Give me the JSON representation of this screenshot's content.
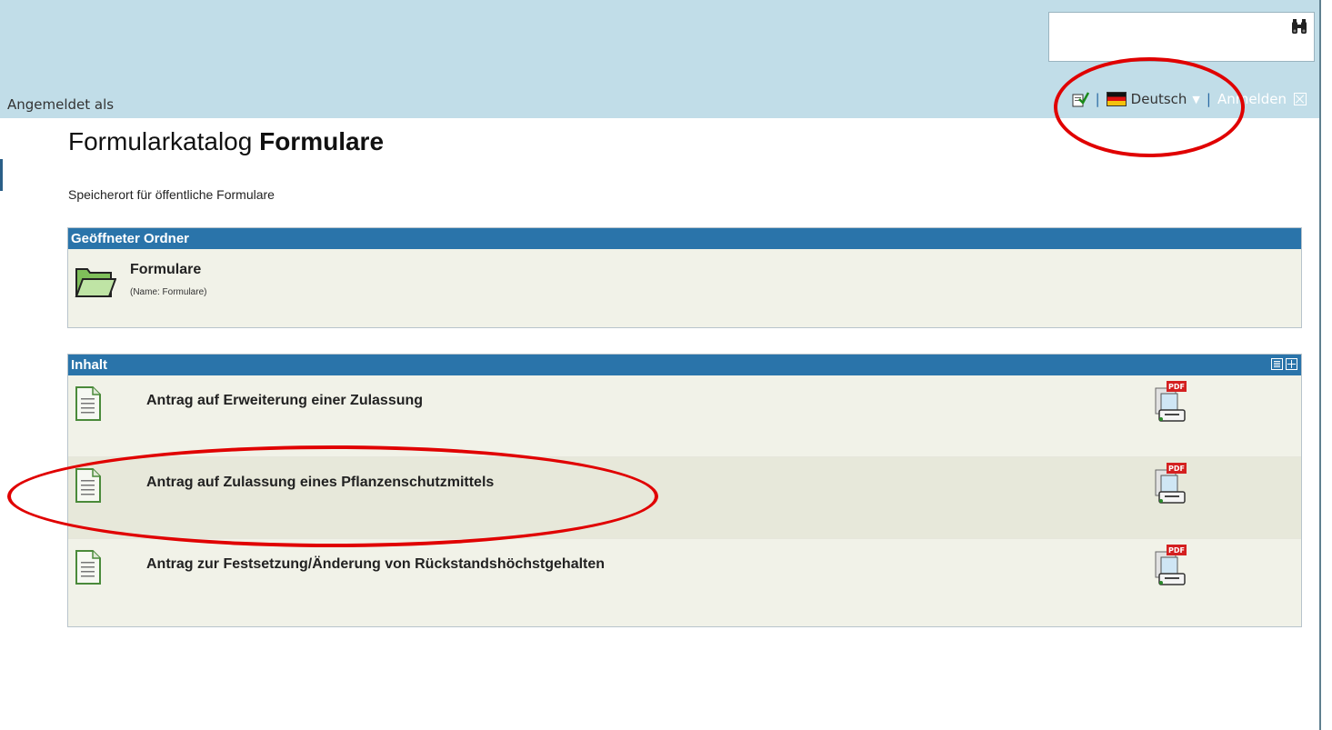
{
  "header": {
    "logged_in_label": "Angemeldet als",
    "language": "Deutsch",
    "login_label": "Anmelden"
  },
  "page": {
    "title_prefix": "Formularkatalog",
    "title_bold": "Formulare",
    "subtitle": "Speicherort für öffentliche Formulare"
  },
  "folder_panel": {
    "heading": "Geöffneter Ordner",
    "folder_name": "Formulare",
    "folder_meta": "(Name: Formulare)"
  },
  "content_panel": {
    "heading": "Inhalt",
    "items": [
      {
        "title": "Antrag auf Erweiterung einer Zulassung"
      },
      {
        "title": "Antrag auf Zulassung eines Pflanzenschutzmittels"
      },
      {
        "title": "Antrag zur Festsetzung/Änderung von Rückstandshöchstgehalten"
      }
    ]
  },
  "icons": {
    "search": "binoculars-icon",
    "pdf_badge": "PDF"
  },
  "colors": {
    "topbar": "#c1dde8",
    "panel_header": "#2a74aa",
    "panel_bg": "#f1f2e8",
    "annotation": "#e00000"
  }
}
